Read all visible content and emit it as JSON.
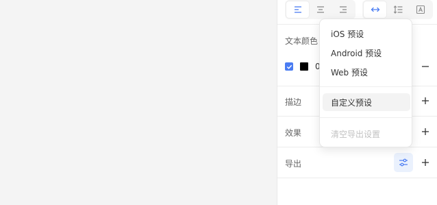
{
  "toolbar": {
    "align_left": "align-left-icon",
    "align_center": "align-center-icon",
    "align_right": "align-right-icon",
    "width_auto": "horizontal-resize-icon",
    "line_height": "line-height-icon",
    "text_box": "text-box-icon"
  },
  "sections": {
    "text_color": "文本颜色",
    "color_value_prefix": "0",
    "stroke": "描边",
    "effects": "效果",
    "export": "导出"
  },
  "menu": {
    "items": [
      {
        "label": "iOS 预设"
      },
      {
        "label": "Android 预设"
      },
      {
        "label": "Web 预设"
      },
      {
        "label": "自定义预设"
      },
      {
        "label": "清空导出设置"
      }
    ]
  },
  "colors": {
    "accent": "#4a7cf2",
    "swatch": "#000000"
  }
}
